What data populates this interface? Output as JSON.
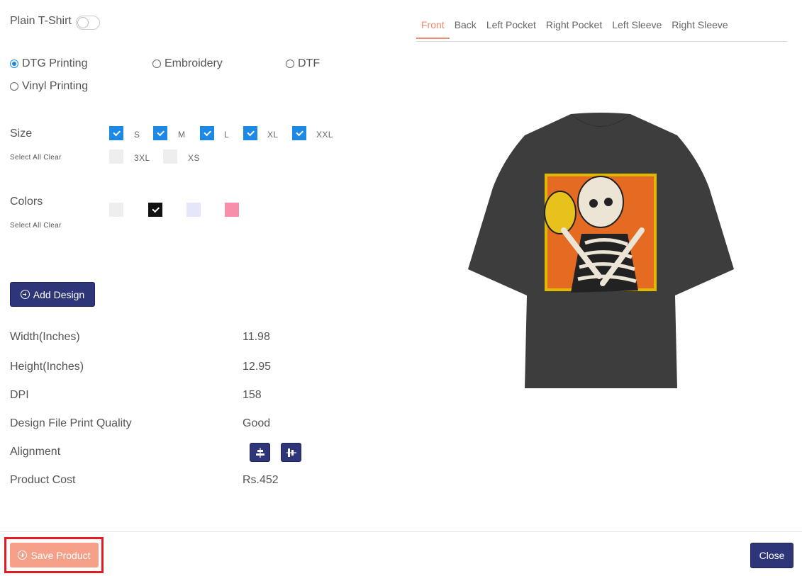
{
  "plain_tshirt": {
    "label": "Plain T-Shirt",
    "enabled": false
  },
  "print_methods": [
    {
      "label": "DTG Printing",
      "selected": true
    },
    {
      "label": "Embroidery",
      "selected": false
    },
    {
      "label": "DTF",
      "selected": false
    },
    {
      "label": "Vinyl Printing",
      "selected": false
    }
  ],
  "size": {
    "label": "Size",
    "select_all": "Select All",
    "clear": "Clear",
    "options": [
      {
        "label": "S",
        "checked": true
      },
      {
        "label": "M",
        "checked": true
      },
      {
        "label": "L",
        "checked": true
      },
      {
        "label": "XL",
        "checked": true
      },
      {
        "label": "XXL",
        "checked": true
      },
      {
        "label": "3XL",
        "checked": false
      },
      {
        "label": "XS",
        "checked": false
      }
    ]
  },
  "colors": {
    "label": "Colors",
    "select_all": "Select All",
    "clear": "Clear",
    "swatches": [
      {
        "color": "#eeeeee",
        "selected": false
      },
      {
        "color": "#111111",
        "selected": true
      },
      {
        "color": "#e6e6fa",
        "selected": false
      },
      {
        "color": "#f78fab",
        "selected": false
      }
    ]
  },
  "add_design_label": "Add Design",
  "specs": {
    "width_label": "Width(Inches)",
    "width_value": "11.98",
    "height_label": "Height(Inches)",
    "height_value": "12.95",
    "dpi_label": "DPI",
    "dpi_value": "158",
    "quality_label": "Design File Print Quality",
    "quality_value": "Good",
    "alignment_label": "Alignment",
    "alignment_icons": [
      "align-center-horizontal-icon",
      "align-center-vertical-icon"
    ],
    "cost_label": "Product Cost",
    "cost_value": "Rs.452"
  },
  "tabs": [
    {
      "label": "Front",
      "active": true
    },
    {
      "label": "Back",
      "active": false
    },
    {
      "label": "Left Pocket",
      "active": false
    },
    {
      "label": "Right Pocket",
      "active": false
    },
    {
      "label": "Left Sleeve",
      "active": false
    },
    {
      "label": "Right Sleeve",
      "active": false
    }
  ],
  "footer": {
    "save_label": "Save Product",
    "close_label": "Close"
  },
  "theme": {
    "primary": "#2e3579",
    "accent": "#f08a6c",
    "check": "#1e88e5",
    "highlight": "#e31b23"
  }
}
